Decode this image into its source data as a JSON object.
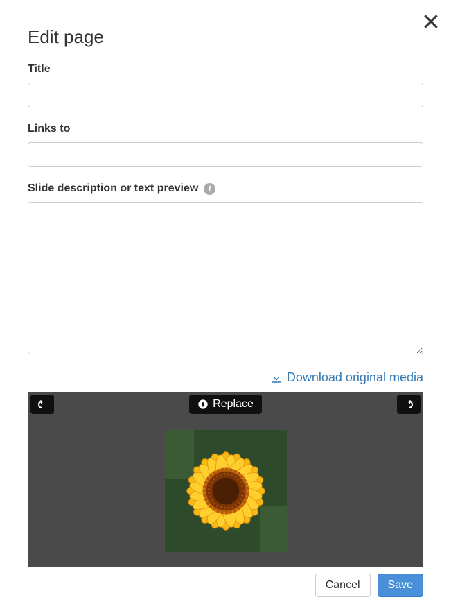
{
  "header": {
    "title": "Edit page"
  },
  "fields": {
    "title": {
      "label": "Title",
      "value": ""
    },
    "links_to": {
      "label": "Links to",
      "value": ""
    },
    "description": {
      "label": "Slide description or text preview",
      "value": ""
    }
  },
  "media": {
    "download_label": "Download original media",
    "replace_label": "Replace",
    "rotate_left_name": "rotate-left-icon",
    "rotate_right_name": "rotate-right-icon",
    "image_alt": "sunflower"
  },
  "buttons": {
    "cancel": "Cancel",
    "save": "Save"
  }
}
